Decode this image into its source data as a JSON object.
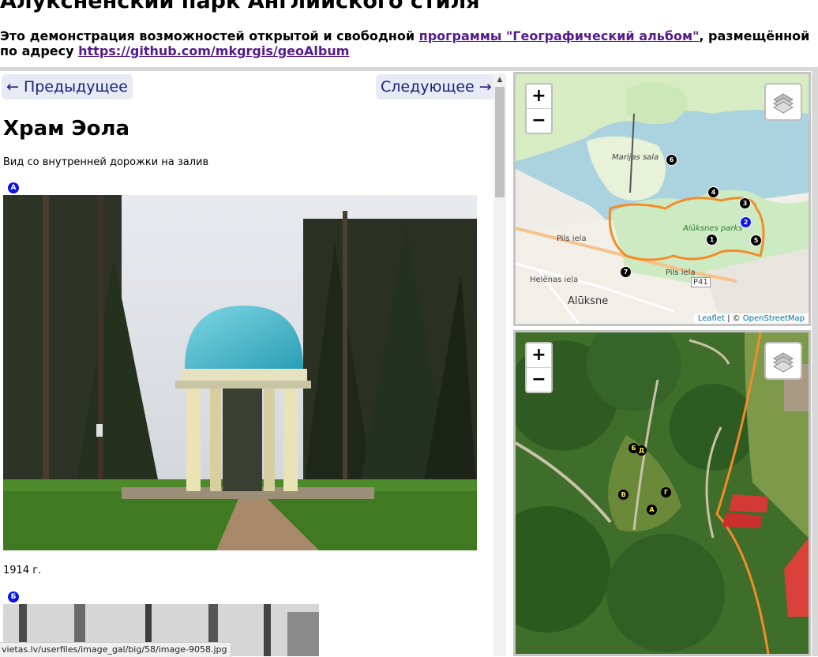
{
  "header": {
    "title": "Алуксненский парк Английского стиля",
    "intro_prefix": "Это демонстрация возможностей открытой и свободной ",
    "intro_link": "программы \"Географический альбом\"",
    "intro_middle": ", размещённой по адресу ",
    "intro_url": "https://github.com/mkgrgis/geoAlbum"
  },
  "nav": {
    "prev": "← Предыдущее",
    "next": "Следующее →"
  },
  "item": {
    "title": "Храм Эола",
    "caption": "Вид со внутренней дорожки на залив",
    "photos": [
      {
        "marker": "А",
        "caption": "1914 г."
      },
      {
        "marker": "Б"
      }
    ]
  },
  "status_url": "vietas.lv/userfiles/image_gal/big/58/image-9058.jpg",
  "map_top": {
    "zoom_in": "+",
    "zoom_out": "−",
    "attribution_link": "Leaflet",
    "attribution_rest": " | © ",
    "attribution_osm": "OpenStreetMap",
    "labels": {
      "island": "Marijas sala",
      "park": "Alūksnes parks",
      "town": "Alūksne",
      "road": "P41",
      "street1": "Pils iela",
      "street2": "Helēnas iela",
      "street3": "Pils iela"
    },
    "markers": [
      "6",
      "4",
      "3",
      "2",
      "1",
      "5",
      "7"
    ],
    "colors": {
      "water": "#aad3df",
      "park": "#c8ecc8",
      "boundary": "#f28c28",
      "selected": "#0a14e8"
    }
  },
  "map_bottom": {
    "zoom_in": "+",
    "zoom_out": "−",
    "markers": [
      "Б",
      "Д",
      "В",
      "Г",
      "А"
    ]
  }
}
